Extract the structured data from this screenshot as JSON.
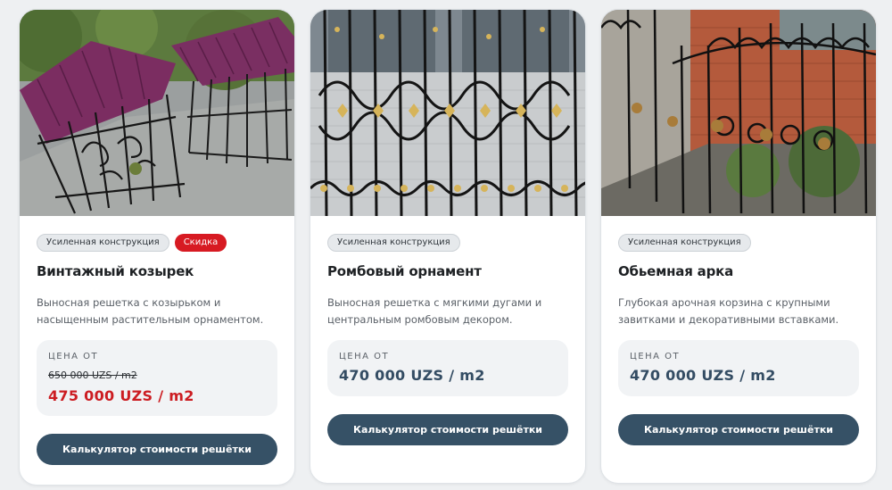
{
  "cards": [
    {
      "tags": [
        "Усиленная конструкция",
        "Скидка"
      ],
      "title": "Винтажный козырек",
      "description": "Выносная решетка с козырьком и насыщенным растительным орнаментом.",
      "price_label": "ЦЕНА ОТ",
      "old_price": "650 000 UZS / m2",
      "price": "475 000 UZS / m2",
      "button": "Калькулятор стоимости решётки",
      "image": "wrought-iron-window-grille-with-purple-canopy"
    },
    {
      "tags": [
        "Усиленная конструкция"
      ],
      "title": "Ромбовый орнамент",
      "description": "Выносная решетка с мягкими дугами и центральным ромбовым декором.",
      "price_label": "ЦЕНА ОТ",
      "price": "470 000 UZS / m2",
      "button": "Калькулятор стоимости решётки",
      "image": "black-window-grille-with-gold-rhombus-ornament"
    },
    {
      "tags": [
        "Усиленная конструкция"
      ],
      "title": "Обьемная арка",
      "description": "Глубокая арочная корзина с крупными завитками и декоративными вставками.",
      "price_label": "ЦЕНА ОТ",
      "price": "470 000 UZS / m2",
      "button": "Калькулятор стоимости решётки",
      "image": "arched-black-grille-with-bronze-balls"
    }
  ],
  "colors": {
    "page_background": "#eef0f2",
    "button": "#365166",
    "price": "#334c63",
    "discount_price": "#cc1d22",
    "discount_tag": "#d71a22"
  }
}
